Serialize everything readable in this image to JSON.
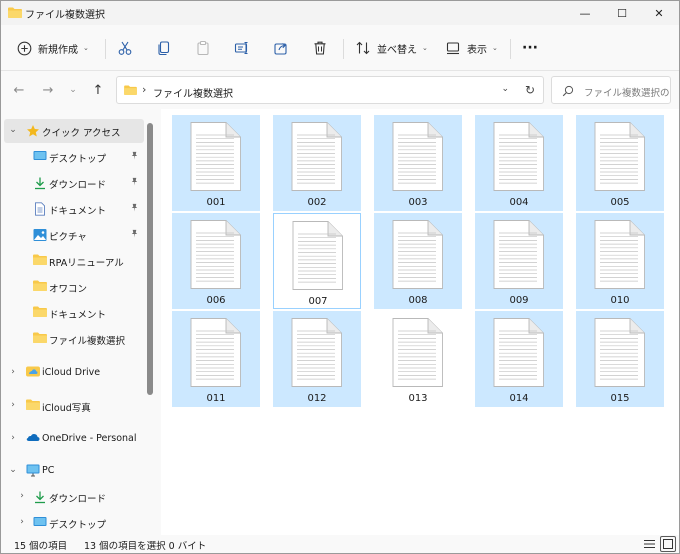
{
  "window": {
    "title": "ファイル複数選択",
    "controls": {
      "minimize": "—",
      "maximize": "☐",
      "close": "✕"
    }
  },
  "toolbar": {
    "new_label": "新規作成",
    "sort_label": "並べ替え",
    "view_label": "表示",
    "more_label": "···"
  },
  "navigation": {
    "back": "←",
    "forward": "→",
    "recent": "⌄",
    "up": "↑"
  },
  "address": {
    "separator": "›",
    "path": "ファイル複数選択",
    "dropdown": "⌄",
    "refresh": "↻"
  },
  "search": {
    "placeholder": "ファイル複数選択の..."
  },
  "sidebar": {
    "items": [
      {
        "label": "クイック アクセス",
        "icon": "star-icon",
        "expander": "⌄",
        "selected": true
      },
      {
        "label": "デスクトップ",
        "icon": "desktop-icon",
        "pinned": true
      },
      {
        "label": "ダウンロード",
        "icon": "download-icon",
        "pinned": true
      },
      {
        "label": "ドキュメント",
        "icon": "document-icon",
        "pinned": true
      },
      {
        "label": "ピクチャ",
        "icon": "pictures-icon",
        "pinned": true
      },
      {
        "label": "RPAリニューアル",
        "icon": "folder-icon"
      },
      {
        "label": "オワコン",
        "icon": "folder-icon"
      },
      {
        "label": "ドキュメント",
        "icon": "folder-icon"
      },
      {
        "label": "ファイル複数選択",
        "icon": "folder-icon"
      },
      {
        "label": "iCloud Drive",
        "icon": "icloud-icon",
        "expander": "›"
      },
      {
        "label": "iCloud写真",
        "icon": "folder-icon",
        "expander": "›"
      },
      {
        "label": "OneDrive - Personal",
        "icon": "onedrive-icon",
        "expander": "›"
      },
      {
        "label": "PC",
        "icon": "pc-icon",
        "expander": "⌄"
      },
      {
        "label": "ダウンロード",
        "icon": "download-icon",
        "expander": "›"
      },
      {
        "label": "デスクトップ",
        "icon": "desktop-icon",
        "expander": "›"
      }
    ],
    "pin_glyph": "📌"
  },
  "files": [
    {
      "name": "001",
      "state": "selected"
    },
    {
      "name": "002",
      "state": "selected"
    },
    {
      "name": "003",
      "state": "selected"
    },
    {
      "name": "004",
      "state": "selected"
    },
    {
      "name": "005",
      "state": "selected"
    },
    {
      "name": "006",
      "state": "selected"
    },
    {
      "name": "007",
      "state": "focus"
    },
    {
      "name": "008",
      "state": "selected"
    },
    {
      "name": "009",
      "state": "selected"
    },
    {
      "name": "010",
      "state": "selected"
    },
    {
      "name": "011",
      "state": "selected"
    },
    {
      "name": "012",
      "state": "selected"
    },
    {
      "name": "013",
      "state": "none"
    },
    {
      "name": "014",
      "state": "selected"
    },
    {
      "name": "015",
      "state": "selected"
    }
  ],
  "status": {
    "item_count": "15 個の項目",
    "selection": "13 個の項目を選択  0 バイト"
  },
  "colors": {
    "selection": "#cce8ff",
    "focus_border": "#99d1ff",
    "accent": "#0067c0",
    "folder": "#f8c94a"
  }
}
